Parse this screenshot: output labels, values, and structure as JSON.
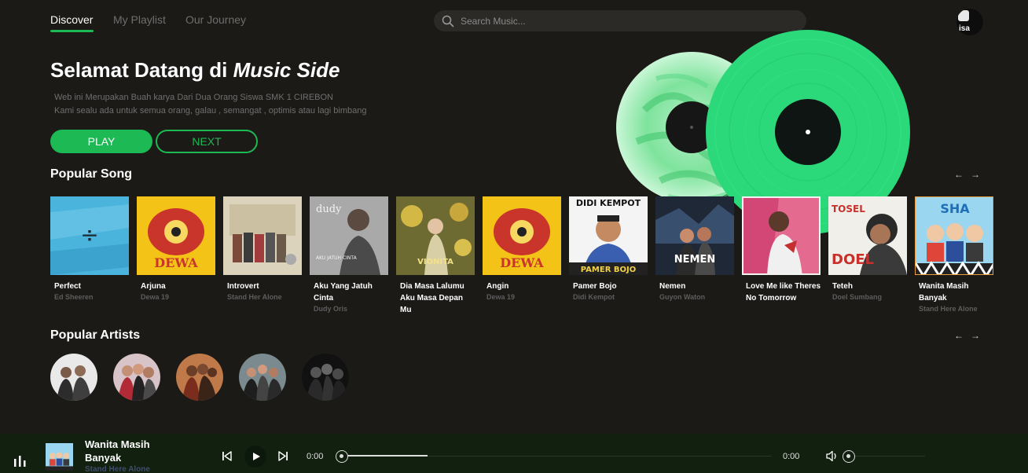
{
  "nav": {
    "tabs": [
      {
        "label": "Discover"
      },
      {
        "label": "My Playlist"
      },
      {
        "label": "Our Journey"
      }
    ],
    "search": {
      "placeholder": "Search Music..."
    },
    "avatar_alt": "isa"
  },
  "hero": {
    "title_prefix": "Selamat Datang di ",
    "title_emphasis": "Music Side",
    "line1": "Web ini Merupakan Buah karya Dari Dua Orang Siswa SMK 1 CIREBON",
    "line2": "Kami sealu ada untuk semua orang, galau , semangat , optimis atau lagi bimbang",
    "play_label": "PLAY",
    "next_label": "NEXT",
    "accent_color": "#1db954"
  },
  "popular_songs": {
    "title": "Popular Song",
    "items": [
      {
        "title": "Perfect",
        "artist": "Ed Sheeren"
      },
      {
        "title": "Arjuna",
        "artist": "Dewa 19"
      },
      {
        "title": "Introvert",
        "artist": "Stand Her Alone"
      },
      {
        "title": "Aku Yang Jatuh Cinta",
        "artist": "Dudy Oris"
      },
      {
        "title": "Dia Masa Lalumu Aku Masa Depan Mu",
        "artist": ""
      },
      {
        "title": "Angin",
        "artist": "Dewa 19"
      },
      {
        "title": "Pamer Bojo",
        "artist": "Didi Kempot"
      },
      {
        "title": "Nemen",
        "artist": "Guyon Waton"
      },
      {
        "title": "Love Me like Theres No Tomorrow",
        "artist": ""
      },
      {
        "title": "Teteh",
        "artist": "Doel Sumbang"
      },
      {
        "title": "Wanita Masih Banyak",
        "artist": "Stand Here Alone"
      }
    ],
    "cover_texts": {
      "divide": "÷",
      "dewa": "DEWA",
      "dudy": "dudy",
      "dudy_sub": "AKU JATUH CINTA",
      "vionita": "VIONITA",
      "didi_top": "DIDI KEMPOT",
      "didi_bottom": "PAMER BOJO",
      "nemen": "NEMEN",
      "tosen": "TOSEL",
      "doel": "DOEL",
      "sha": "SHA"
    }
  },
  "popular_artists": {
    "title": "Popular Artists",
    "count": 5
  },
  "player": {
    "now_title": "Wanita Masih Banyak",
    "now_artist": "Stand Here Alone",
    "time_current": "0:00",
    "time_total": "0:00",
    "progress": 0.2
  }
}
